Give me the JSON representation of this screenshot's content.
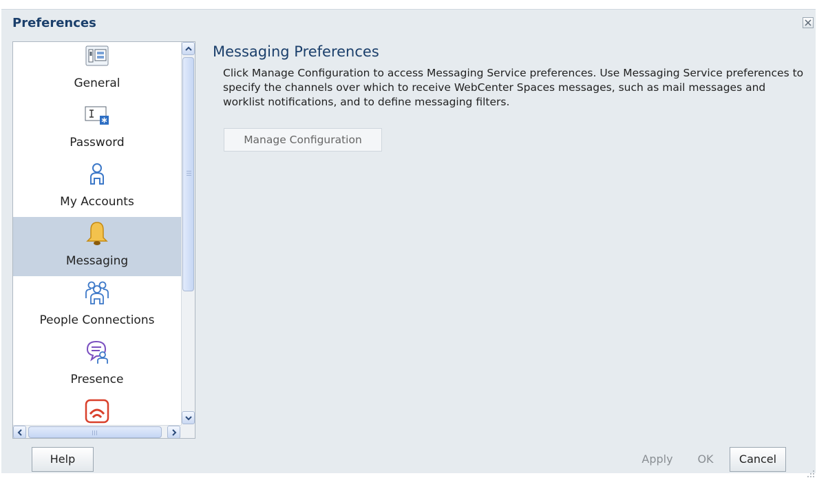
{
  "dialog": {
    "title": "Preferences"
  },
  "nav": {
    "items": [
      {
        "label": "General",
        "icon": "general-settings-icon"
      },
      {
        "label": "Password",
        "icon": "password-icon"
      },
      {
        "label": "My Accounts",
        "icon": "user-account-icon"
      },
      {
        "label": "Messaging",
        "icon": "bell-icon",
        "selected": true
      },
      {
        "label": "People Connections",
        "icon": "people-group-icon"
      },
      {
        "label": "Presence",
        "icon": "presence-chat-icon"
      },
      {
        "label": "",
        "icon": "rss-feed-icon"
      }
    ]
  },
  "content": {
    "title": "Messaging Preferences",
    "description": "Click Manage Configuration to access Messaging Service preferences. Use Messaging Service preferences to specify the channels over which to receive WebCenter Spaces messages, such as mail messages and worklist notifications, and to define messaging filters.",
    "manage_button": "Manage Configuration"
  },
  "footer": {
    "help": "Help",
    "apply": "Apply",
    "ok": "OK",
    "cancel": "Cancel"
  },
  "colors": {
    "title": "#1b3f6b",
    "selected_row": "#c7d3e2",
    "panel_bg": "#e6ebef"
  }
}
